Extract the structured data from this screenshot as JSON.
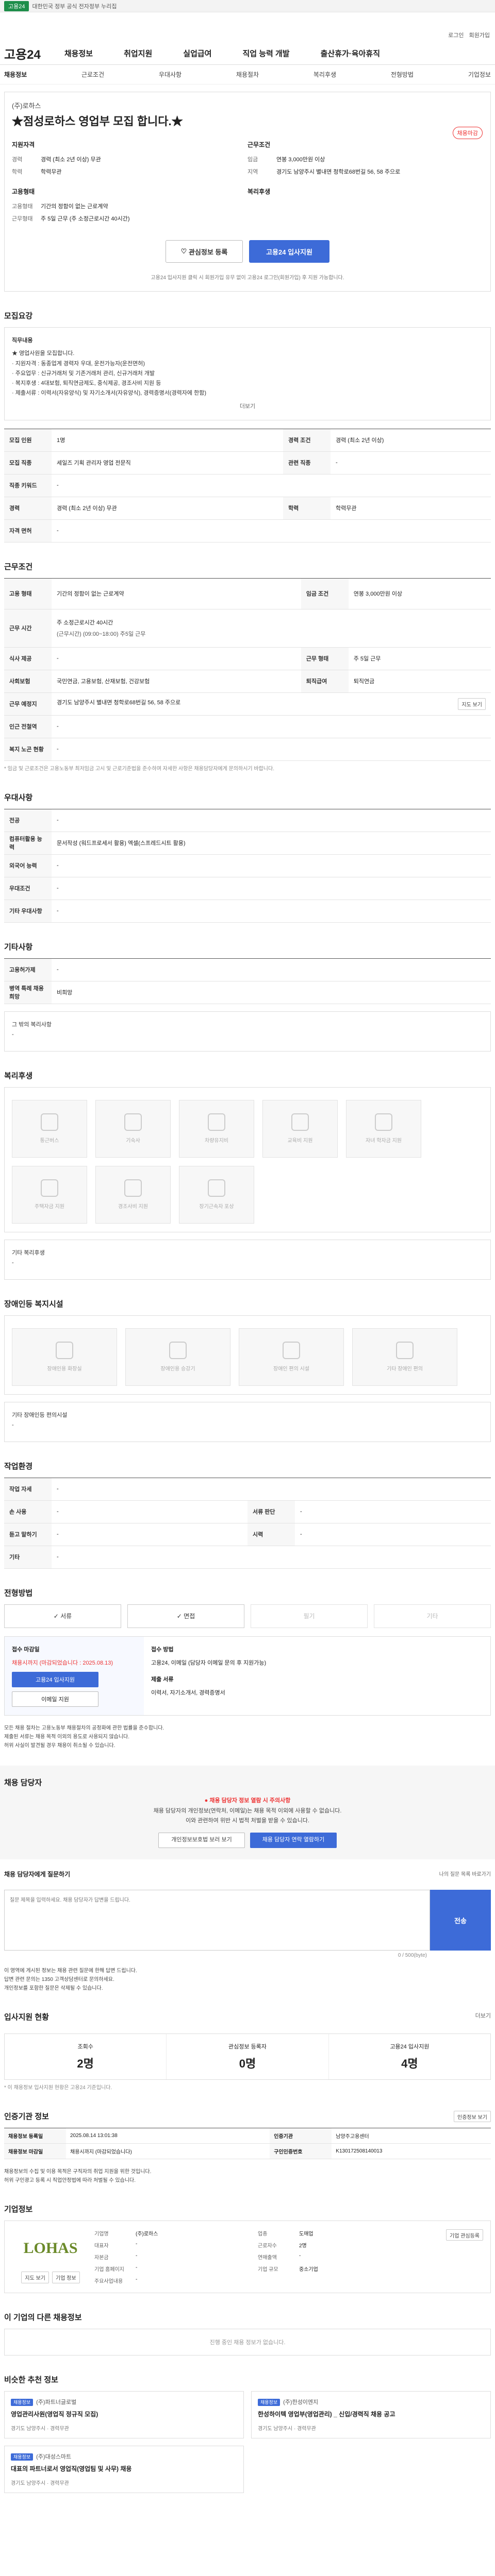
{
  "topbar": {
    "badge": "고용24",
    "text": "대한민국 정부 공식 전자정부 누리집"
  },
  "util": {
    "login": "로그인",
    "signup": "회원가입"
  },
  "gnb": {
    "logo": "고용24",
    "menu": [
      "채용정보",
      "취업지원",
      "실업급여",
      "직업 능력 개발",
      "출산휴가·육아휴직"
    ]
  },
  "subnav": [
    "채용정보",
    "근로조건",
    "우대사항",
    "채용절차",
    "복리후생",
    "전형방법",
    "기업정보"
  ],
  "head": {
    "company": "(주)로하스",
    "title": "★점성로하스 영업부 모집 합니다.★",
    "tag": "채용마감",
    "left_title": "지원자격",
    "right_title": "근무조건",
    "left": [
      {
        "k": "경력",
        "v": "경력 (최소 2년 이상) 무관"
      },
      {
        "k": "학력",
        "v": "학력무관"
      }
    ],
    "right": [
      {
        "k": "임금",
        "v": "연봉 3,000만원 이상"
      },
      {
        "k": "지역",
        "v": "경기도 남양주시 별내면 청학로68번길 56, 58 주으로"
      }
    ],
    "left2_title": "고용형태",
    "right2_title": "복리후생",
    "left2": [
      {
        "k": "고용형태",
        "v": "기간의 정함이 없는 근로계약"
      },
      {
        "k": "근무형태",
        "v": "주 5일 근무 (주 소정근로시간 40시간)"
      }
    ],
    "save": "관심정보 등록",
    "apply": "고용24 입사지원",
    "note": "고용24 입사지원 클릭 시 회원가입 유무 없이 고용24 로그인(회원가입) 후 지원 가능합니다."
  },
  "detail": {
    "title": "모집요강",
    "subtitle": "직무내용",
    "bullets": [
      "★ 영업사원을 모집합니다.",
      "· 지원자격 : 동종업계 경력자 우대, 운전가능자(운전면허)",
      "· 주요업무 : 신규거래처 및 기존거래처 관리, 신규거래처 개발",
      "· 복지후생 : 4대보험, 퇴직연금제도, 중식제공, 경조사비 지원 등",
      "· 제출서류 : 이력서(자유양식) 및 자기소개서(자유양식), 경력증명서(경력자에 한함)"
    ],
    "more": "더보기"
  },
  "summary": [
    [
      "모집 인원",
      "1명",
      "경력 조건",
      "경력 (최소 2년 이상)"
    ],
    [
      "모집 직종",
      "세일즈 기획 관리자 영업 전문직",
      "관련 직종",
      "-"
    ],
    [
      "직종 키워드",
      "-",
      "",
      ""
    ],
    [
      "경력",
      "경력 (최소 2년 이상) 무관",
      "학력",
      "학력무관"
    ],
    [
      "자격 면허",
      "-",
      "",
      ""
    ]
  ],
  "conditions": {
    "title": "근무조건",
    "rows": [
      [
        "고용 형태",
        "기간의 정함이 없는 근로계약",
        "임금 조건",
        "연봉 3,000만원 이상"
      ],
      [
        "근무 시간",
        "주 소정근로시간 40시간",
        "",
        ""
      ],
      [
        "식사 제공",
        "-",
        "근무 형태",
        "주 5일 근무"
      ],
      [
        "사회보험",
        "국민연금, 고용보험, 산재보험, 건강보험",
        "퇴직급여",
        "퇴직연금"
      ],
      [
        "근무 예정지",
        "경기도 남양주시 별내면 청학로68번길 56, 58 주으로",
        "",
        ""
      ],
      [
        "인근 전철역",
        "-",
        "",
        ""
      ],
      [
        "복지 노곤 현황",
        "-",
        "",
        ""
      ]
    ],
    "time": "(근무시간) (09:00~18:00) 주5일 근무",
    "map": "지도 보기",
    "note": "* 임금 및 근로조건은 고용노동부 최저임금 고시 및 근로기준법을 준수하며 자세한 사항은 채용담당자에게 문의하시기 바랍니다."
  },
  "pref": {
    "title": "우대사항",
    "rows": [
      [
        "전공",
        "-"
      ],
      [
        "컴퓨터활용 능력",
        "문서작성 (워드프로세서 활용) 엑셀(스프레드시트 활용)"
      ],
      [
        "외국어 능력",
        "-"
      ],
      [
        "우대조건",
        "-"
      ],
      [
        "기타 우대사항",
        "-"
      ]
    ]
  },
  "other": {
    "title": "기타사항",
    "rows": [
      [
        "고용허가제",
        "-"
      ],
      [
        "병역 특례 채용 희망",
        "비희망"
      ]
    ],
    "label": "그 밖의 복리사항",
    "val": "-"
  },
  "welfare": {
    "title": "복리후생",
    "items": [
      "통근버스",
      "기숙사",
      "차량유지비",
      "교육비 지원",
      "자녀 학자금 지원",
      "주택자금 지원",
      "경조사비 지원",
      "장기근속자 포상"
    ],
    "label": "기타 복리후생",
    "val": "-"
  },
  "disabled": {
    "title": "장애인등 복지시설",
    "items": [
      "장애인용 화장실",
      "장애인용 승강기",
      "장애인 편의 시설",
      "기타 장애인 편의"
    ],
    "label": "기타 장애인등 편의시설",
    "val": "-"
  },
  "env": {
    "title": "작업환경",
    "rows": [
      [
        "작업 자세",
        "-",
        "",
        ""
      ],
      [
        "손 사용",
        "-",
        "서류 판단",
        "-"
      ],
      [
        "듣고 말하기",
        "-",
        "시력",
        "-"
      ],
      [
        "기타",
        "-",
        "",
        ""
      ]
    ]
  },
  "method": {
    "title": "전형방법",
    "items": [
      "서류",
      "면접",
      "필기",
      "기타"
    ],
    "apply_label": "접수 마감일",
    "deadline": "채용시까지 (마감되었습니다 : 2025.08.13)",
    "apply_btn": "고용24 입사지원",
    "email_btn": "이메일 지원",
    "step_label": "접수 방법",
    "step_val": "고용24, 이메일 (담당자 이메일 문의 후 지원가능)",
    "docs_label": "제출 서류",
    "docs_val": "이력서, 자기소개서, 경력증명서",
    "notes": [
      "모든 채용 절차는 고용노동부 채용절차의 공정화에 관한 법률을 준수합니다.",
      "제출된 서류는 채용 목적 이외의 용도로 사용되지 않습니다.",
      "허위 사실이 발견될 경우 채용이 취소될 수 있습니다."
    ]
  },
  "contact": {
    "title": "채용 담당자",
    "banner": "채용 담당자 정보 열람 시 주의사항",
    "lines": [
      "채용 담당자의 개인정보(연락처, 이메일)는 채용 목적 이외에 사용할 수 없습니다.",
      "이와 관련하여 위반 시 법적 처벌을 받을 수 있습니다."
    ],
    "b1": "개인정보보호법 보러 보기",
    "b2": "채용 담당자 연락 열람하기"
  },
  "qna": {
    "title": "채용 담당자에게 질문하기",
    "hint": "나의 질문 목록 바로가기",
    "placeholder": "질문 제목을 입력하세요. 채용 담당자가 답변을 드립니다.",
    "count": "0 / 500(byte)",
    "send": "전송",
    "notes": [
      "이 영역에 게시된 정보는 채용 관련 질문에 한해 답변 드립니다.",
      "답변 관련 문의는 1350 고객상담센터로 문의하세요.",
      "개인정보를 포함한 질문은 삭제될 수 있습니다."
    ]
  },
  "stats": {
    "title": "입사지원 현황",
    "more": "더보기",
    "items": [
      {
        "label": "조회수",
        "value": "2명"
      },
      {
        "label": "관심정보 등록자",
        "value": "0명"
      },
      {
        "label": "고용24 입사지원",
        "value": "4명"
      }
    ],
    "note": "* 이 채용정보 입사지원 현황은 고용24 기준입니다."
  },
  "info": {
    "title": "인증기관 정보",
    "btn": "인증정보 보기",
    "rows": [
      [
        "채용정보 등록일",
        "2025.08.14 13:01:38",
        "인증기관",
        "남양주고용센터"
      ],
      [
        "채용정보 마감일",
        "채용시까지 (마감되었습니다)",
        "구인인증번호",
        "K130172508140013"
      ]
    ],
    "notes": [
      "채용정보의 수집 및 이용 목적은 구직자의 취업 지원을 위한 것입니다.",
      "허위 구인광고 등록 시 직업안정법에 따라 처벌될 수 있습니다."
    ]
  },
  "company": {
    "title": "기업정보",
    "logo": "LOHAS",
    "b1": "지도 보기",
    "b2": "기업 정보",
    "rows": [
      [
        "기업명",
        "(주)로하스",
        "업종",
        "도매업"
      ],
      [
        "대표자",
        "-",
        "근로자수",
        "2명"
      ],
      [
        "자본금",
        "-",
        "연매출액",
        "-"
      ],
      [
        "기업 홈페이지",
        "-",
        "기업 규모",
        "중소기업"
      ],
      [
        "주요사업내용",
        "-",
        "",
        ""
      ]
    ],
    "follow": "기업 관심등록"
  },
  "more": {
    "title": "이 기업의 다른 채용정보",
    "empty": "진행 중인 채용 정보가 없습니다."
  },
  "related": {
    "title": "비슷한 추천 정보",
    "cards": [
      {
        "tag": "채용정보",
        "co": "(주)파트너글로벌",
        "t": "영업관리사원(영업직 정규직 모집)",
        "loc": "경기도 남양주시 · 경력무관"
      },
      {
        "tag": "채용정보",
        "co": "(주)한성이엔지",
        "t": "한성하이텍 영업부(영업관리) _ 신입/경력직 채용 공고",
        "loc": "경기도 남양주시 · 경력무관"
      },
      {
        "tag": "채용정보",
        "co": "(주)대성스마트",
        "t": "대표의 파트너로서 영업직(영업팀 및 사무) 채용",
        "loc": "경기도 남양주시 · 경력무관"
      }
    ]
  }
}
